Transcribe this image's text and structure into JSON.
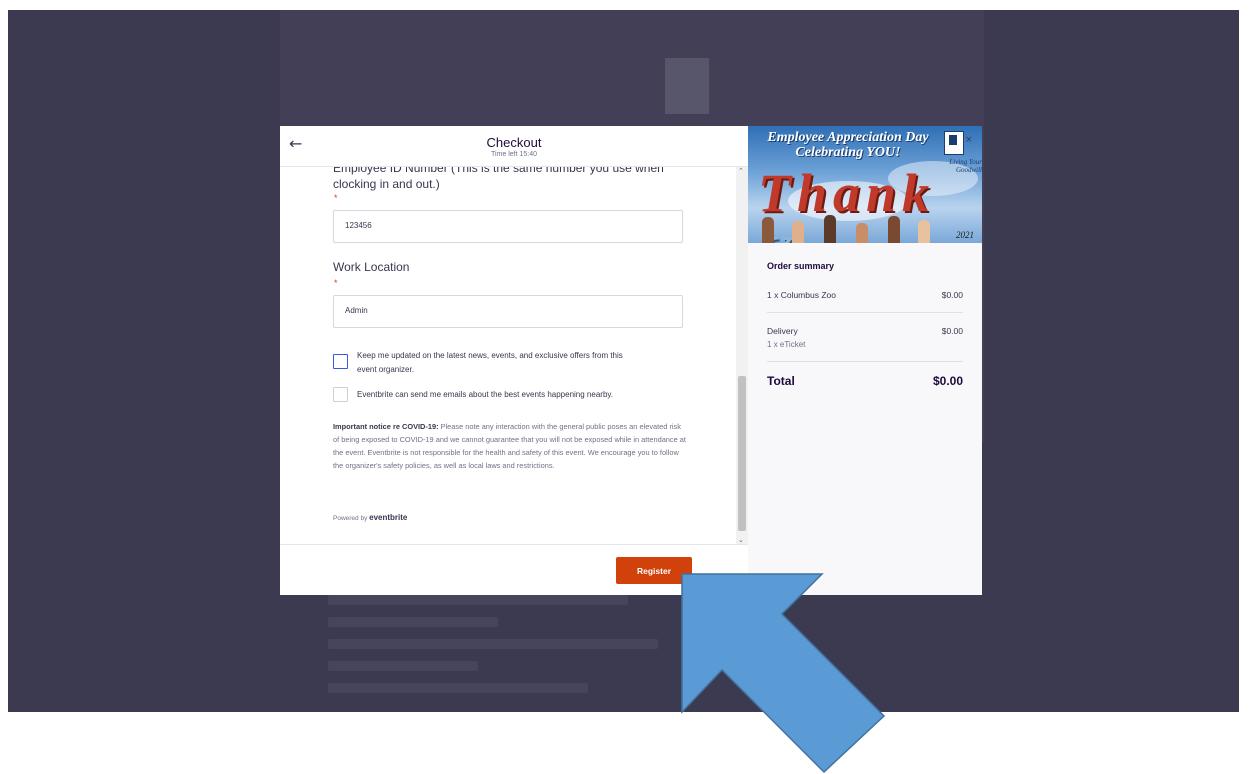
{
  "checkout": {
    "title": "Checkout",
    "time_left": "Time left 15:40",
    "back_icon": "back-arrow-icon"
  },
  "form": {
    "q1_label_line1": "Employee ID Number (This is the same number you use when",
    "q1_label_line2": "clocking in and out.)",
    "q1_required": "*",
    "q1_value": "123456",
    "q2_label": "Work Location",
    "q2_required": "*",
    "q2_value": "Admin",
    "cb1_line1": "Keep me updated on the latest news, events, and exclusive offers from this",
    "cb1_line2": "event organizer.",
    "cb2_label": "Eventbrite can send me emails about the best events happening nearby.",
    "notice_bold": "Important notice re COVID-19:",
    "notice_text": " Please note any interaction with the general public poses an elevated risk of being exposed to COVID-19 and we cannot guarantee that you will not be exposed while in attendance at the event. Eventbrite is not responsible for the health and safety of this event. We encourage you to follow the organizer's safety policies, as well as local laws and restrictions.",
    "powered_by": "Powered by ",
    "powered_brand": "eventbrite",
    "register_label": "Register"
  },
  "banner": {
    "title_line1": "Employee Appreciation Day",
    "title_line2": "Celebrating YOU!",
    "tagline_line1": "Living Your",
    "tagline_line2": "Goodwill",
    "thank": "Thank",
    "you": "You",
    "year": "2021"
  },
  "order_summary": {
    "heading": "Order summary",
    "item_label": "1 x Columbus Zoo",
    "item_price": "$0.00",
    "delivery_label": "Delivery",
    "delivery_sub": "1 x eTicket",
    "delivery_price": "$0.00",
    "total_label": "Total",
    "total_price": "$0.00"
  },
  "colors": {
    "accent": "#d1410c",
    "focus": "#3659e3",
    "backdrop": "#3b3a50",
    "arrow": "#5b9bd5"
  }
}
